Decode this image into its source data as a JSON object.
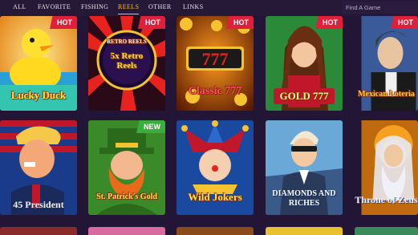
{
  "nav": {
    "items": [
      {
        "label": "ALL",
        "active": false
      },
      {
        "label": "FAVORITE",
        "active": false
      },
      {
        "label": "FISHING",
        "active": false
      },
      {
        "label": "REELS",
        "active": true
      },
      {
        "label": "OTHER",
        "active": false
      },
      {
        "label": "LINKS",
        "active": false
      }
    ]
  },
  "search": {
    "placeholder": "Find A Game"
  },
  "tiles": [
    {
      "title": "Lucky Duck",
      "badge": "HOT"
    },
    {
      "title": "5x Retro Reels",
      "top_text": "RETRO REELS",
      "badge": "HOT"
    },
    {
      "title": "Classic 777",
      "badge": "HOT"
    },
    {
      "title": "GOLD 777",
      "badge": "HOT"
    },
    {
      "title": "Mexican Loteria",
      "badge": "HOT"
    },
    {
      "title": "45 President",
      "badge": ""
    },
    {
      "title": "St. Patrick's Gold",
      "badge": "NEW"
    },
    {
      "title": "Wild Jokers",
      "badge": ""
    },
    {
      "title": "DIAMONDS AND RICHES",
      "badge": ""
    },
    {
      "title": "Throne of Zeus",
      "badge": ""
    }
  ],
  "colors": {
    "accent": "#f5c230",
    "hot": "#e0203a",
    "new": "#3aae3a",
    "background": "#231536"
  }
}
